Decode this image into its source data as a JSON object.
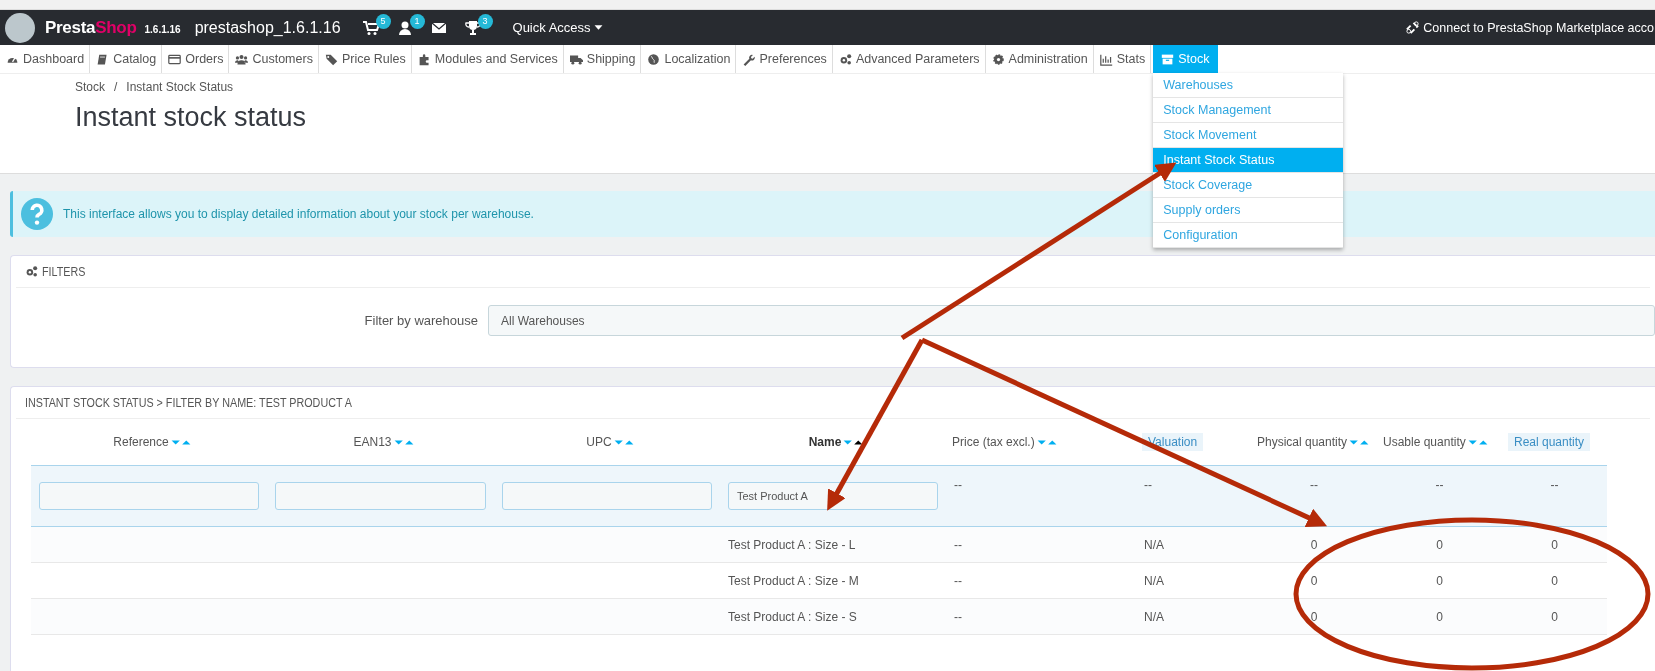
{
  "top_bar": {
    "brand": [
      "Presta",
      "Shop"
    ],
    "version": "1.6.1.16",
    "shop_name": "prestashop_1.6.1.16",
    "notifications": [
      {
        "kind": "cart",
        "badge": "5"
      },
      {
        "kind": "user",
        "badge": "1"
      },
      {
        "kind": "envelope"
      },
      {
        "kind": "trophy",
        "badge": "3"
      }
    ],
    "quick_access": "Quick Access",
    "marketplace_link": "Connect to PrestaShop Marketplace acco"
  },
  "nav": [
    {
      "label": "Dashboard",
      "selected": false
    },
    {
      "label": "Catalog",
      "selected": false
    },
    {
      "label": "Orders",
      "selected": false
    },
    {
      "label": "Customers",
      "selected": false
    },
    {
      "label": "Price Rules",
      "selected": false
    },
    {
      "label": "Modules and Services",
      "selected": false
    },
    {
      "label": "Shipping",
      "selected": false
    },
    {
      "label": "Localization",
      "selected": false
    },
    {
      "label": "Preferences",
      "selected": false
    },
    {
      "label": "Advanced Parameters",
      "selected": false
    },
    {
      "label": "Administration",
      "selected": false
    },
    {
      "label": "Stats",
      "selected": false
    },
    {
      "label": "Stock",
      "selected": true
    }
  ],
  "submenu": [
    {
      "label": "Warehouses",
      "selected": false
    },
    {
      "label": "Stock Management",
      "selected": false
    },
    {
      "label": "Stock Movement",
      "selected": false
    },
    {
      "label": "Instant Stock Status",
      "selected": true
    },
    {
      "label": "Stock Coverage",
      "selected": false
    },
    {
      "label": "Supply orders",
      "selected": false
    },
    {
      "label": "Configuration",
      "selected": false
    }
  ],
  "breadcrumb": [
    "Stock",
    "Instant Stock Status"
  ],
  "breadcrumb_separator": "/",
  "page_title": "Instant stock status",
  "info_alert": "This interface allows you to display detailed information about your stock per warehouse.",
  "filters": {
    "title": "FILTERS",
    "label": "Filter by warehouse",
    "value": "All Warehouses"
  },
  "table": {
    "title": "INSTANT STOCK STATUS > FILTER BY NAME: TEST PRODUCT A",
    "columns": [
      {
        "label": "Reference",
        "sortable": true,
        "sorted_ascending": false
      },
      {
        "label": "EAN13",
        "sortable": true,
        "sorted_ascending": false
      },
      {
        "label": "UPC",
        "sortable": true,
        "sorted_ascending": false
      },
      {
        "label": "Name",
        "sortable": true,
        "sorted_ascending": true
      },
      {
        "label": "Price (tax excl.)",
        "sortable": true,
        "sorted_ascending": false
      },
      {
        "label": "Valuation",
        "sortable": false
      },
      {
        "label": "Physical quantity",
        "sortable": true,
        "sorted_ascending": false
      },
      {
        "label": "Usable quantity",
        "sortable": true,
        "sorted_ascending": false
      },
      {
        "label": "Real quantity",
        "sortable": false
      }
    ],
    "filter_row": [
      {
        "kind": "input"
      },
      {
        "kind": "input"
      },
      {
        "kind": "input"
      },
      {
        "kind": "input",
        "value": "Test Product A"
      },
      {
        "kind": "text",
        "value": "--"
      },
      {
        "kind": "text",
        "value": "--"
      },
      {
        "kind": "text",
        "value": "--"
      },
      {
        "kind": "text",
        "value": "--"
      },
      {
        "kind": "text",
        "value": "--"
      }
    ],
    "rows": [
      [
        "",
        "",
        "",
        "Test Product A : Size - L",
        "--",
        "N/A",
        "0",
        "0",
        "0"
      ],
      [
        "",
        "",
        "",
        "Test Product A : Size - M",
        "--",
        "N/A",
        "0",
        "0",
        "0"
      ],
      [
        "",
        "",
        "",
        "Test Product A : Size - S",
        "--",
        "N/A",
        "0",
        "0",
        "0"
      ]
    ]
  }
}
